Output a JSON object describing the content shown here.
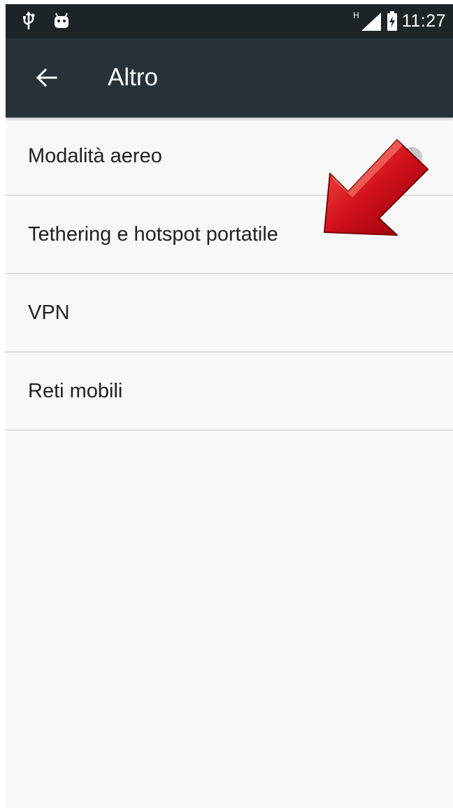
{
  "status_bar": {
    "icons_left": [
      "usb-icon",
      "android-icon"
    ],
    "network_type": "H",
    "icons_right": [
      "signal-icon",
      "battery-charging-icon"
    ],
    "time": "11:27"
  },
  "app_bar": {
    "back_icon": "arrow-left-icon",
    "title": "Altro"
  },
  "list": {
    "items": [
      {
        "label": "Modalità aereo",
        "toggle": "off"
      },
      {
        "label": "Tethering e hotspot portatile"
      },
      {
        "label": "VPN"
      },
      {
        "label": "Reti mobili"
      }
    ]
  },
  "annotation": {
    "arrow_icon": "red-arrow-pointer-icon",
    "color": "#d0101a"
  },
  "colors": {
    "status_bar": "#1c2427",
    "app_bar": "#263238",
    "background": "#f8f8f8",
    "divider": "#dcdcdc",
    "text": "#212121"
  }
}
